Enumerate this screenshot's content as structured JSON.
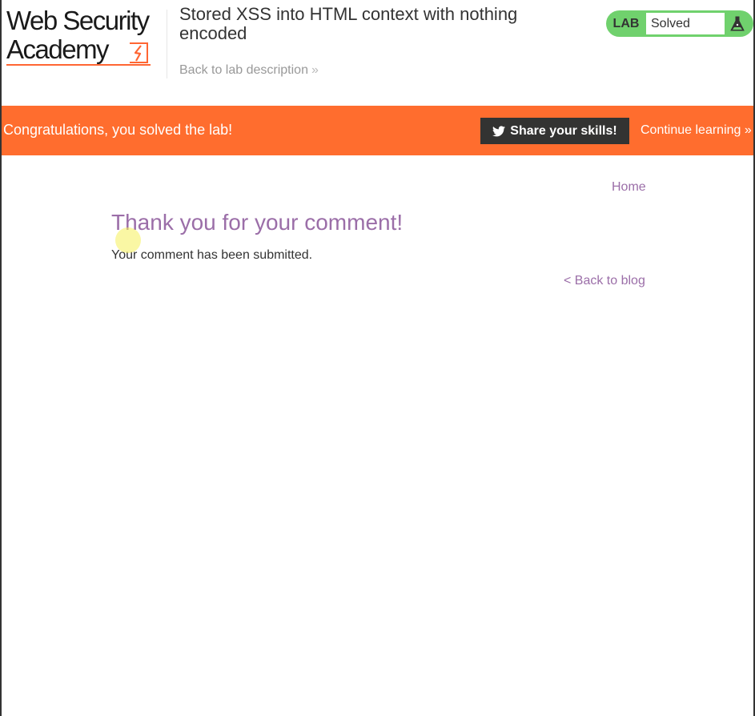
{
  "header": {
    "logo": {
      "line1": "Web Security",
      "line2": "Academy",
      "accent_color": "#ff6633",
      "bolt_icon": "lightning-bolt-icon"
    },
    "lab_title": "Stored XSS into HTML context with nothing encoded",
    "back_to_description": "Back to lab description",
    "back_chevron": "»",
    "status_widget": {
      "tag": "LAB",
      "status": "Solved",
      "color": "#70d16d",
      "icon": "flask-icon"
    }
  },
  "notification": {
    "message": "Congratulations, you solved the lab!",
    "share_label": "Share your skills!",
    "share_icon": "twitter-icon",
    "continue_label": "Continue learning",
    "continue_chevron": "»",
    "background_color": "#ff6d2e"
  },
  "nav": {
    "home": "Home"
  },
  "content": {
    "title": "Thank you for your comment!",
    "message": "Your comment has been submitted.",
    "back_to_blog": "< Back to blog",
    "link_color": "#9b6ea8"
  }
}
